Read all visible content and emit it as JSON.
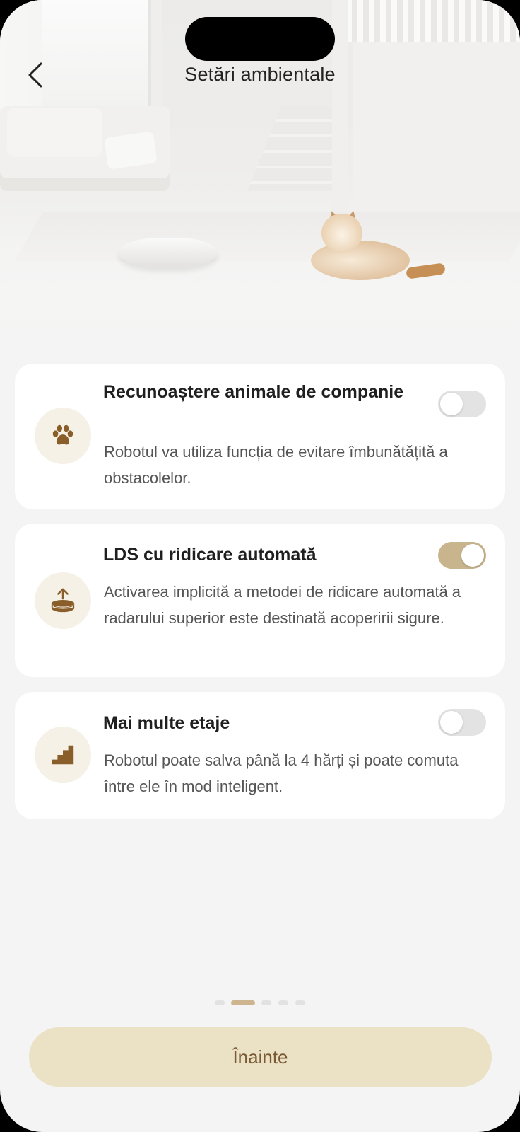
{
  "header": {
    "title": "Setări ambientale",
    "back_icon": "chevron-left-icon"
  },
  "settings": [
    {
      "icon": "paw-icon",
      "title": "Recunoaștere animale de companie",
      "description": "Robotul va utiliza funcția de evitare îmbunătățită a obstacolelor.",
      "enabled": false
    },
    {
      "icon": "lds-lift-icon",
      "title": "LDS cu ridicare automată",
      "description": "Activarea implicită a metodei de ridicare automată a radarului superior este destinată acoperirii sigure.",
      "enabled": true
    },
    {
      "icon": "stairs-icon",
      "title": "Mai multe etaje",
      "description": "Robotul poate salva până la 4 hărți și poate comuta între ele în mod inteligent.",
      "enabled": false
    }
  ],
  "pager": {
    "total": 5,
    "current": 2
  },
  "next_button": {
    "label": "Înainte"
  },
  "colors": {
    "accent": "#c8b58e",
    "icon_brown": "#8a5e2a",
    "button_bg": "#ebe2c6",
    "button_text": "#7a5a34",
    "toggle_off": "#e3e3e3",
    "background": "#f4f4f4"
  }
}
